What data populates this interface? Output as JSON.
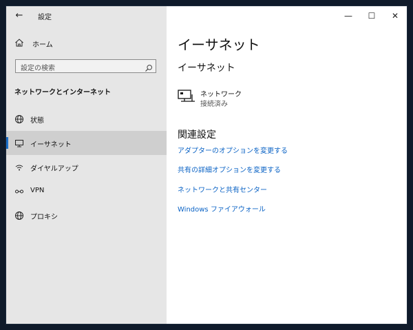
{
  "window": {
    "app_title": "設定",
    "back_label": "←",
    "minimize": "—",
    "maximize": "☐",
    "close": "✕"
  },
  "sidebar": {
    "home_label": "ホーム",
    "search_placeholder": "設定の検索",
    "section_title": "ネットワークとインターネット",
    "items": [
      {
        "label": "状態",
        "icon": "globe-status-icon"
      },
      {
        "label": "イーサネット",
        "icon": "monitor-icon",
        "selected": true
      },
      {
        "label": "ダイヤルアップ",
        "icon": "dialup-icon"
      },
      {
        "label": "VPN",
        "icon": "vpn-icon"
      },
      {
        "label": "プロキシ",
        "icon": "globe-icon"
      }
    ]
  },
  "main": {
    "page_title": "イーサネット",
    "sub_title": "イーサネット",
    "adapter": {
      "name": "ネットワーク",
      "status": "接続済み",
      "icon": "network-monitor-icon"
    },
    "related_title": "関連設定",
    "links": [
      "アダプターのオプションを変更する",
      "共有の詳細オプションを変更する",
      "ネットワークと共有センター",
      "Windows ファイアウォール"
    ]
  },
  "colors": {
    "accent": "#1a6fc9",
    "link": "#0b63c5",
    "sidebar_bg": "#e6e6e6",
    "selected_bg": "#cfcfcf"
  }
}
